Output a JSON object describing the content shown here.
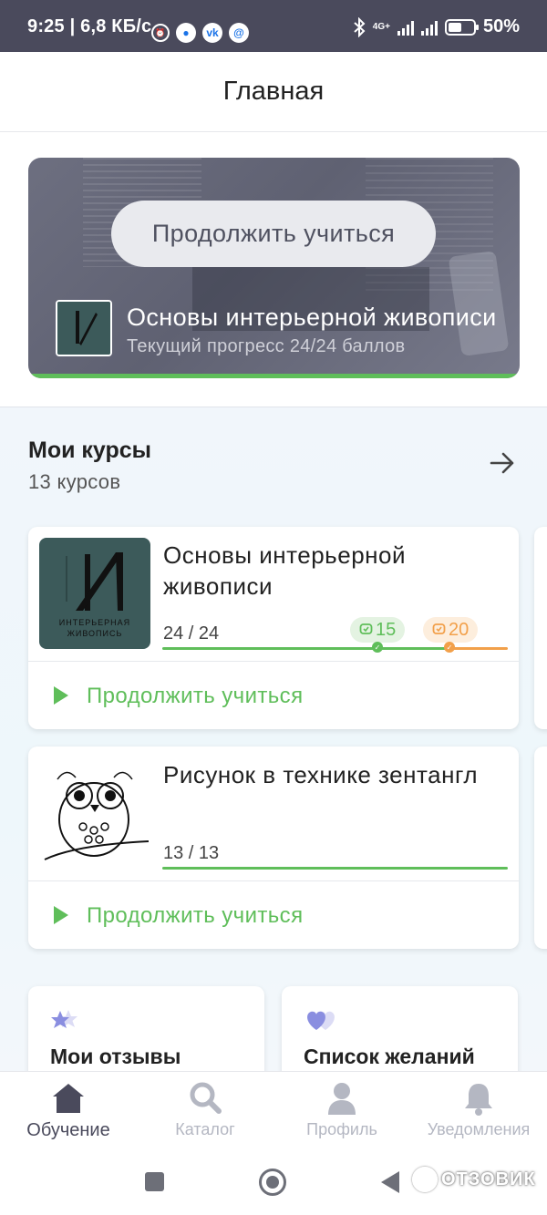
{
  "status_bar": {
    "time": "9:25 | 6,8 КБ/с",
    "network": "4G+",
    "battery": "50%",
    "icons": [
      "alarm-icon",
      "chat-icon",
      "vk-icon",
      "mail-icon",
      "bluetooth-icon",
      "signal-icon",
      "battery-icon"
    ]
  },
  "header": {
    "title": "Главная"
  },
  "hero": {
    "button_label": "Продолжить учиться",
    "course_title": "Основы интерьерной живописи",
    "progress_text": "Текущий прогресс 24/24 баллов",
    "progress_fraction": 1.0
  },
  "my_courses": {
    "title": "Мои курсы",
    "subtitle": "13 курсов",
    "courses": [
      {
        "title": "Основы интерьерной живописи",
        "count": "24 / 24",
        "progress_fraction": 1.0,
        "badge_green": "15",
        "badge_orange": "20",
        "continue_label": "Продолжить учиться",
        "thumb_text_line1": "ИНТЕРЬЕРНАЯ",
        "thumb_text_line2": "ЖИВОПИСЬ"
      },
      {
        "title": "Рисунок в технике зентангл",
        "count": "13 / 13",
        "progress_fraction": 1.0,
        "continue_label": "Продолжить учиться"
      }
    ]
  },
  "shortcuts": [
    {
      "label": "Мои отзывы",
      "icon": "stars-icon"
    },
    {
      "label": "Список желаний",
      "icon": "heart-icon"
    }
  ],
  "bottom_nav": [
    {
      "label": "Обучение",
      "icon": "home-icon",
      "active": true
    },
    {
      "label": "Каталог",
      "icon": "search-icon",
      "active": false
    },
    {
      "label": "Профиль",
      "icon": "profile-icon",
      "active": false
    },
    {
      "label": "Уведомления",
      "icon": "bell-icon",
      "active": false
    }
  ],
  "watermark": "ОТЗОВИК",
  "colors": {
    "accent_green": "#5fbe5a",
    "accent_orange": "#f2a04a",
    "nav_active": "#4a4a5c",
    "nav_inactive": "#b4b7c2"
  }
}
